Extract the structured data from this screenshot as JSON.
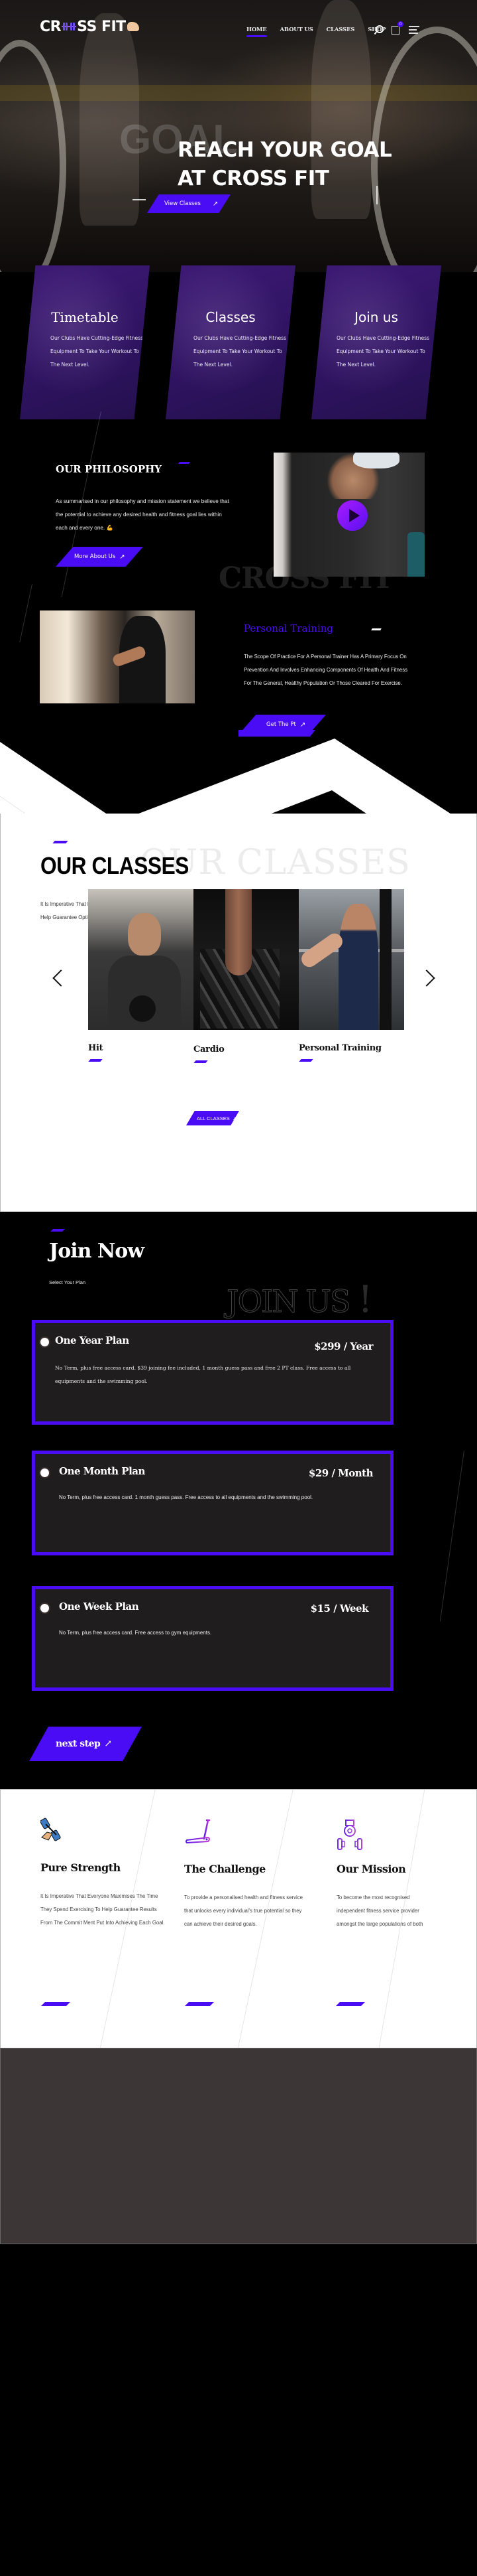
{
  "brand": {
    "logo_text_left": "CR",
    "logo_text_right": "SS FIT",
    "accent_color": "#4a0bf5"
  },
  "nav": {
    "items": [
      {
        "label": "HOME",
        "active": true
      },
      {
        "label": "ABOUT US",
        "active": false
      },
      {
        "label": "CLASSES",
        "active": false
      },
      {
        "label": "SHOP",
        "active": false
      }
    ],
    "icons": [
      "search-icon",
      "cart-icon",
      "menu-icon"
    ],
    "cart_count": "0"
  },
  "hero": {
    "watermark": "GOAL",
    "title_line1": "REACH YOUR GOAL",
    "title_line2": "AT CROSS FIT",
    "cta_label": "View Classes",
    "cta_icon": "arrow-up-right-icon"
  },
  "features": [
    {
      "title": "Timetable",
      "text": "Our Clubs Have Cutting-Edge Fitness Equipment To Take Your Workout To The Next Level."
    },
    {
      "title": "Classes",
      "text": "Our Clubs Have Cutting-Edge Fitness Equipment To Take Your Workout To The Next Level."
    },
    {
      "title": "Join us",
      "text": "Our Clubs Have Cutting-Edge Fitness Equipment To Take Your Workout To The Next Level."
    }
  ],
  "philosophy": {
    "heading": "OUR PHILOSOPHY",
    "text": "As summarised in our philosophy and mission statement we believe that the potential to achieve any desired health and fitness goal lies within each and every one. 💪",
    "cta_label": "More About Us",
    "watermark": "CROSS FIT"
  },
  "personal_training": {
    "heading": "Personal Training",
    "text": "The Scope Of Practice For A Personal Trainer Has A Primary Focus On Prevention And Involves Enhancing Components Of Health And Fitness For The General, Healthy Population Or Those Cleared For Exercise.",
    "cta_label": "Get The Pt"
  },
  "our_classes": {
    "ghost": "OUR CLASSES",
    "heading": "OUR CLASSES",
    "text": "It Is Imperative That Everyone Maxmises The Time They Spend Exercising To Help Guarantee Optimal Results.",
    "items": [
      {
        "title": "Hit"
      },
      {
        "title": "Cardio"
      },
      {
        "title": "Personal Training"
      }
    ],
    "all_label": "ALL CLASSES"
  },
  "join": {
    "heading": "Join Now",
    "subheading": "Select Your Plan",
    "ghost": "JOIN US",
    "ghost_bang": "!",
    "plans": [
      {
        "name": "One Year Plan",
        "price": "$299 / Year",
        "desc": "No Term, plus free access card. $39 joining fee included, 1 month guess pass and free 2 PT class. Free access to all equipments and the swimming pool."
      },
      {
        "name": "One Month Plan",
        "price": "$29 / Month",
        "desc": "No Term, plus free access card. 1 month guess pass. Free access to all equipments and the swimming pool."
      },
      {
        "name": "One Week Plan",
        "price": "$15 / Week",
        "desc": "No Term, plus free access card. Free access to gym equipments."
      }
    ],
    "next_label": "next step"
  },
  "values": [
    {
      "icon": "dumbbell-hand-icon",
      "title": "Pure Strength",
      "text": "It Is Imperative That Everyone Maximises The Time They Spend Exercising To Help Guarantee Results From The Commit Ment Put Into Achieving Each Goal."
    },
    {
      "icon": "treadmill-icon",
      "title": "The Challenge",
      "text": "To provide a personalised health and fitness service that unlocks every individual's true potential so they can achieve their desired goals."
    },
    {
      "icon": "kettlebell-dumbbell-icon",
      "title": "Our Mission",
      "text": "To become the most recognised independent fitness service provider amongst the large populations of both"
    }
  ]
}
